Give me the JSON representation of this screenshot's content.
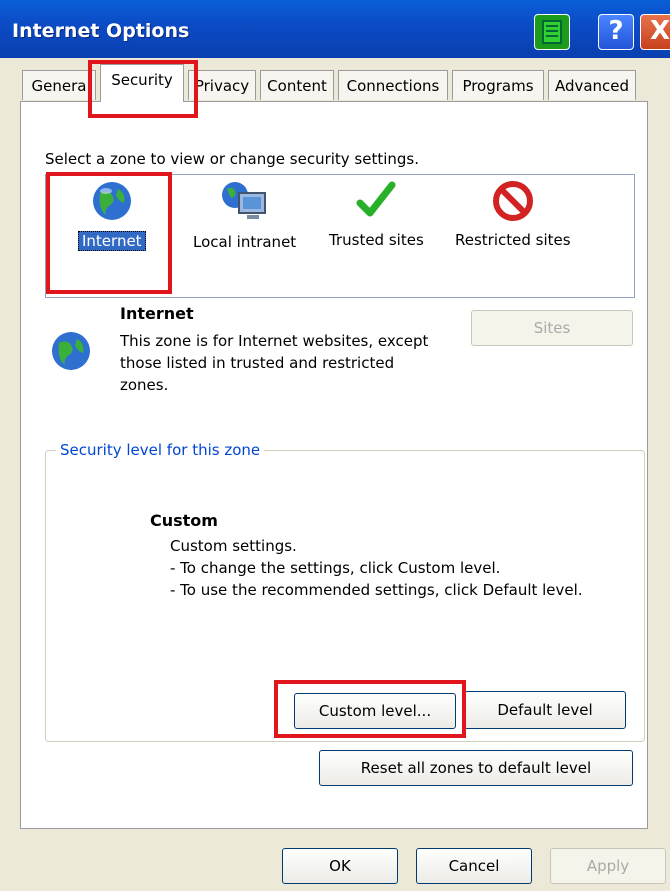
{
  "window": {
    "title": "Internet Options",
    "help_glyph": "?",
    "close_glyph": "X"
  },
  "tabs": [
    {
      "label": "Genera"
    },
    {
      "label": "Security"
    },
    {
      "label": "Privacy"
    },
    {
      "label": "Content"
    },
    {
      "label": "Connections"
    },
    {
      "label": "Programs"
    },
    {
      "label": "Advanced"
    }
  ],
  "active_tab": "Security",
  "security": {
    "zone_caption": "Select a zone to view or change security settings.",
    "zones": [
      {
        "label": "Internet",
        "icon": "globe-icon"
      },
      {
        "label": "Local intranet",
        "icon": "local-intranet-icon"
      },
      {
        "label": "Trusted sites",
        "icon": "checkmark-icon"
      },
      {
        "label": "Restricted sites",
        "icon": "restricted-icon"
      }
    ],
    "selected_zone": "Internet",
    "zone_name": "Internet",
    "zone_description": "This zone is for Internet websites, except those listed in trusted and restricted zones.",
    "sites_button": "Sites",
    "level_group_label": "Security level for this zone",
    "level_title": "Custom",
    "level_description": "Custom settings.\n- To change the settings, click Custom level.\n- To use the recommended settings, click Default level.",
    "custom_level_button": "Custom level...",
    "default_level_button": "Default level",
    "reset_button": "Reset all zones to default level"
  },
  "footer": {
    "ok": "OK",
    "cancel": "Cancel",
    "apply": "Apply"
  },
  "colors": {
    "titlebar": "#0a5fd8",
    "highlight": "#e0161c",
    "selection": "#316ac5"
  }
}
